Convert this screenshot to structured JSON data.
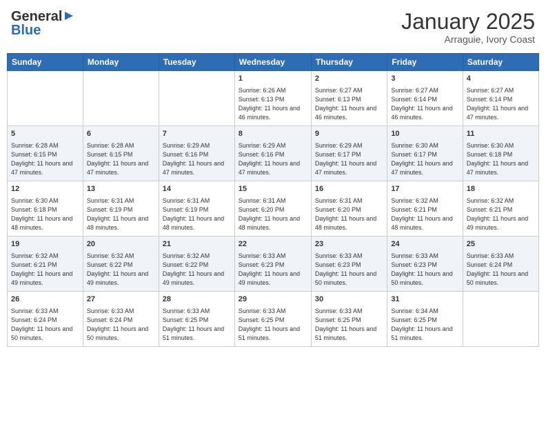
{
  "logo": {
    "general": "General",
    "blue": "Blue"
  },
  "title": {
    "month": "January 2025",
    "location": "Arraguie, Ivory Coast"
  },
  "headers": [
    "Sunday",
    "Monday",
    "Tuesday",
    "Wednesday",
    "Thursday",
    "Friday",
    "Saturday"
  ],
  "weeks": [
    [
      {
        "day": "",
        "sunrise": "",
        "sunset": "",
        "daylight": ""
      },
      {
        "day": "",
        "sunrise": "",
        "sunset": "",
        "daylight": ""
      },
      {
        "day": "",
        "sunrise": "",
        "sunset": "",
        "daylight": ""
      },
      {
        "day": "1",
        "sunrise": "Sunrise: 6:26 AM",
        "sunset": "Sunset: 6:13 PM",
        "daylight": "Daylight: 11 hours and 46 minutes."
      },
      {
        "day": "2",
        "sunrise": "Sunrise: 6:27 AM",
        "sunset": "Sunset: 6:13 PM",
        "daylight": "Daylight: 11 hours and 46 minutes."
      },
      {
        "day": "3",
        "sunrise": "Sunrise: 6:27 AM",
        "sunset": "Sunset: 6:14 PM",
        "daylight": "Daylight: 11 hours and 46 minutes."
      },
      {
        "day": "4",
        "sunrise": "Sunrise: 6:27 AM",
        "sunset": "Sunset: 6:14 PM",
        "daylight": "Daylight: 11 hours and 47 minutes."
      }
    ],
    [
      {
        "day": "5",
        "sunrise": "Sunrise: 6:28 AM",
        "sunset": "Sunset: 6:15 PM",
        "daylight": "Daylight: 11 hours and 47 minutes."
      },
      {
        "day": "6",
        "sunrise": "Sunrise: 6:28 AM",
        "sunset": "Sunset: 6:15 PM",
        "daylight": "Daylight: 11 hours and 47 minutes."
      },
      {
        "day": "7",
        "sunrise": "Sunrise: 6:29 AM",
        "sunset": "Sunset: 6:16 PM",
        "daylight": "Daylight: 11 hours and 47 minutes."
      },
      {
        "day": "8",
        "sunrise": "Sunrise: 6:29 AM",
        "sunset": "Sunset: 6:16 PM",
        "daylight": "Daylight: 11 hours and 47 minutes."
      },
      {
        "day": "9",
        "sunrise": "Sunrise: 6:29 AM",
        "sunset": "Sunset: 6:17 PM",
        "daylight": "Daylight: 11 hours and 47 minutes."
      },
      {
        "day": "10",
        "sunrise": "Sunrise: 6:30 AM",
        "sunset": "Sunset: 6:17 PM",
        "daylight": "Daylight: 11 hours and 47 minutes."
      },
      {
        "day": "11",
        "sunrise": "Sunrise: 6:30 AM",
        "sunset": "Sunset: 6:18 PM",
        "daylight": "Daylight: 11 hours and 47 minutes."
      }
    ],
    [
      {
        "day": "12",
        "sunrise": "Sunrise: 6:30 AM",
        "sunset": "Sunset: 6:18 PM",
        "daylight": "Daylight: 11 hours and 48 minutes."
      },
      {
        "day": "13",
        "sunrise": "Sunrise: 6:31 AM",
        "sunset": "Sunset: 6:19 PM",
        "daylight": "Daylight: 11 hours and 48 minutes."
      },
      {
        "day": "14",
        "sunrise": "Sunrise: 6:31 AM",
        "sunset": "Sunset: 6:19 PM",
        "daylight": "Daylight: 11 hours and 48 minutes."
      },
      {
        "day": "15",
        "sunrise": "Sunrise: 6:31 AM",
        "sunset": "Sunset: 6:20 PM",
        "daylight": "Daylight: 11 hours and 48 minutes."
      },
      {
        "day": "16",
        "sunrise": "Sunrise: 6:31 AM",
        "sunset": "Sunset: 6:20 PM",
        "daylight": "Daylight: 11 hours and 48 minutes."
      },
      {
        "day": "17",
        "sunrise": "Sunrise: 6:32 AM",
        "sunset": "Sunset: 6:21 PM",
        "daylight": "Daylight: 11 hours and 48 minutes."
      },
      {
        "day": "18",
        "sunrise": "Sunrise: 6:32 AM",
        "sunset": "Sunset: 6:21 PM",
        "daylight": "Daylight: 11 hours and 49 minutes."
      }
    ],
    [
      {
        "day": "19",
        "sunrise": "Sunrise: 6:32 AM",
        "sunset": "Sunset: 6:21 PM",
        "daylight": "Daylight: 11 hours and 49 minutes."
      },
      {
        "day": "20",
        "sunrise": "Sunrise: 6:32 AM",
        "sunset": "Sunset: 6:22 PM",
        "daylight": "Daylight: 11 hours and 49 minutes."
      },
      {
        "day": "21",
        "sunrise": "Sunrise: 6:32 AM",
        "sunset": "Sunset: 6:22 PM",
        "daylight": "Daylight: 11 hours and 49 minutes."
      },
      {
        "day": "22",
        "sunrise": "Sunrise: 6:33 AM",
        "sunset": "Sunset: 6:23 PM",
        "daylight": "Daylight: 11 hours and 49 minutes."
      },
      {
        "day": "23",
        "sunrise": "Sunrise: 6:33 AM",
        "sunset": "Sunset: 6:23 PM",
        "daylight": "Daylight: 11 hours and 50 minutes."
      },
      {
        "day": "24",
        "sunrise": "Sunrise: 6:33 AM",
        "sunset": "Sunset: 6:23 PM",
        "daylight": "Daylight: 11 hours and 50 minutes."
      },
      {
        "day": "25",
        "sunrise": "Sunrise: 6:33 AM",
        "sunset": "Sunset: 6:24 PM",
        "daylight": "Daylight: 11 hours and 50 minutes."
      }
    ],
    [
      {
        "day": "26",
        "sunrise": "Sunrise: 6:33 AM",
        "sunset": "Sunset: 6:24 PM",
        "daylight": "Daylight: 11 hours and 50 minutes."
      },
      {
        "day": "27",
        "sunrise": "Sunrise: 6:33 AM",
        "sunset": "Sunset: 6:24 PM",
        "daylight": "Daylight: 11 hours and 50 minutes."
      },
      {
        "day": "28",
        "sunrise": "Sunrise: 6:33 AM",
        "sunset": "Sunset: 6:25 PM",
        "daylight": "Daylight: 11 hours and 51 minutes."
      },
      {
        "day": "29",
        "sunrise": "Sunrise: 6:33 AM",
        "sunset": "Sunset: 6:25 PM",
        "daylight": "Daylight: 11 hours and 51 minutes."
      },
      {
        "day": "30",
        "sunrise": "Sunrise: 6:33 AM",
        "sunset": "Sunset: 6:25 PM",
        "daylight": "Daylight: 11 hours and 51 minutes."
      },
      {
        "day": "31",
        "sunrise": "Sunrise: 6:34 AM",
        "sunset": "Sunset: 6:25 PM",
        "daylight": "Daylight: 11 hours and 51 minutes."
      },
      {
        "day": "",
        "sunrise": "",
        "sunset": "",
        "daylight": ""
      }
    ]
  ]
}
